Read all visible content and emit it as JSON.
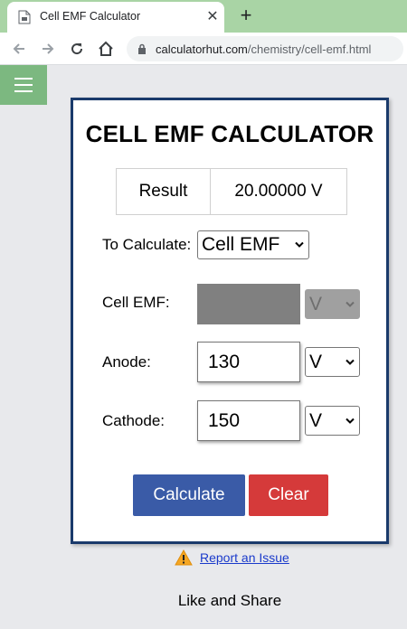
{
  "browser": {
    "tab_title": "Cell EMF Calculator",
    "tab_close": "✕",
    "new_tab": "+",
    "url_domain": "calculatorhut.com",
    "url_path": "/chemistry/cell-emf.html"
  },
  "calculator": {
    "title": "CELL EMF CALCULATOR",
    "result_label": "Result",
    "result_value": "20.00000 V",
    "to_calculate_label": "To Calculate:",
    "to_calculate_value": "Cell EMF",
    "fields": [
      {
        "label": "Cell EMF:",
        "value": "",
        "unit": "V",
        "disabled": true
      },
      {
        "label": "Anode:",
        "value": "130",
        "unit": "V",
        "disabled": false
      },
      {
        "label": "Cathode:",
        "value": "150",
        "unit": "V",
        "disabled": false
      }
    ],
    "calculate_label": "Calculate",
    "clear_label": "Clear"
  },
  "footer": {
    "report_label": "Report an Issue",
    "share_label": "Like and Share"
  },
  "colors": {
    "tabbar": "#a9d4a5",
    "menu_button": "#7cb880",
    "card_border": "#1a3a6b",
    "calculate_button": "#3a5ba7",
    "clear_button": "#d53a3a",
    "link": "#1a3acb"
  },
  "icons": {
    "favicon": "document-icon",
    "back": "arrow-left-icon",
    "forward": "arrow-right-icon",
    "reload": "reload-icon",
    "home": "home-icon",
    "lock": "lock-icon",
    "menu": "hamburger-icon",
    "warning": "warning-icon"
  }
}
